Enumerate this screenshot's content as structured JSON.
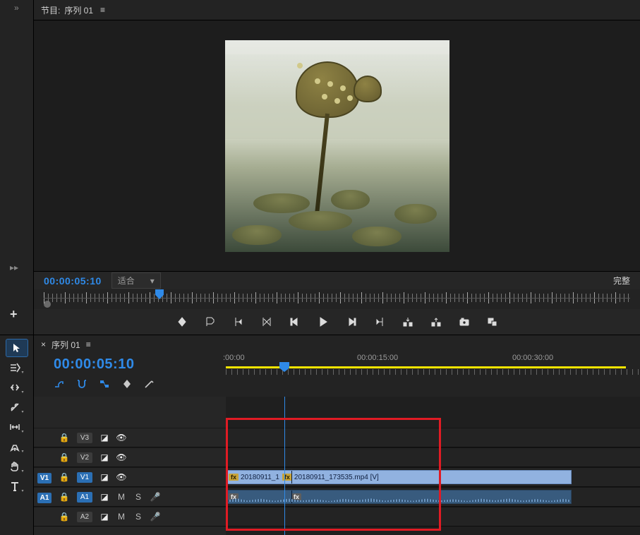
{
  "program": {
    "tab_prefix": "节目:",
    "tab_title": "序列 01",
    "timecode": "00:00:05:10",
    "zoom_label": "适合",
    "quality_label": "完整"
  },
  "ruler": {
    "labels": [
      ":00:00",
      "00:00:15:00",
      "00:00:30:00"
    ]
  },
  "sequence": {
    "tab_title": "序列 01",
    "timecode": "00:00:05:10"
  },
  "tracks": {
    "v3": "V3",
    "v2": "V2",
    "v1": "V1",
    "a1": "A1",
    "a2": "A2",
    "src_v1": "V1",
    "src_a1": "A1",
    "M": "M",
    "S": "S"
  },
  "clips": {
    "fx": "fx",
    "v_clip1": "20180911_1",
    "v_clip2": "20180911_173535.mp4 [V]"
  },
  "icons": {
    "close": "×",
    "menu": "≡",
    "chevron_down": "▾",
    "plus": "+"
  }
}
